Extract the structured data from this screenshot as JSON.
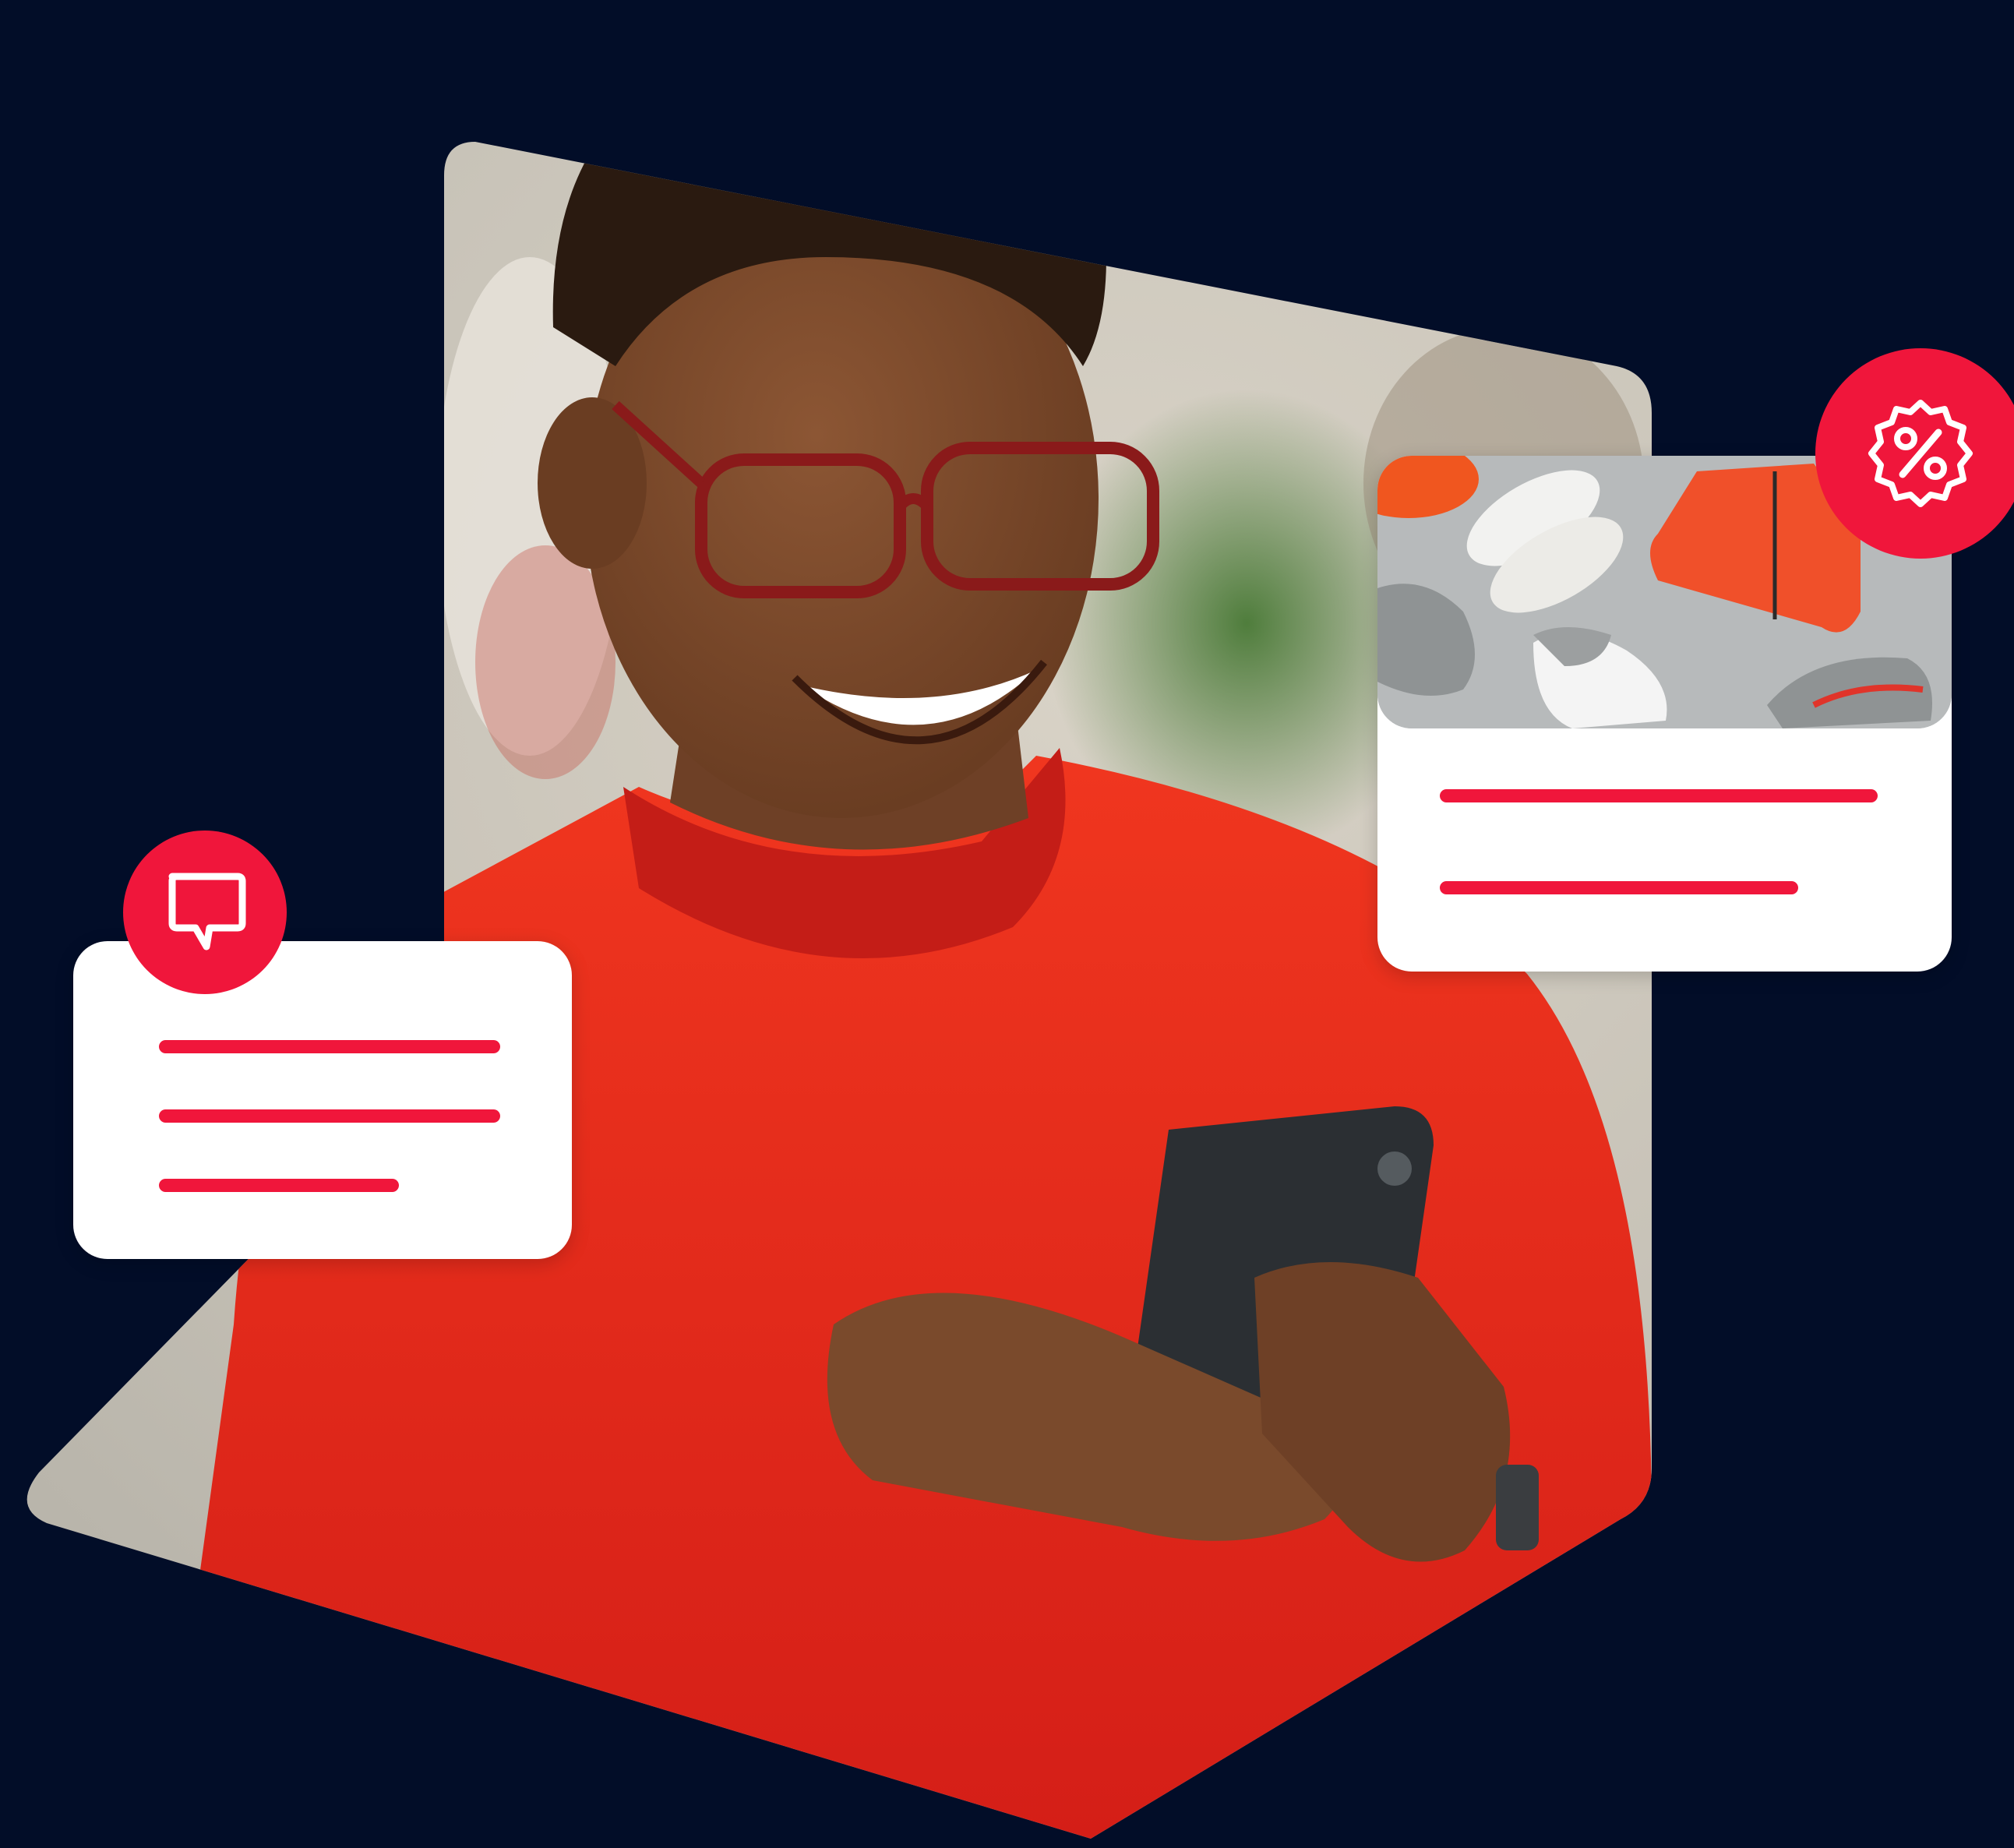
{
  "scene": {
    "description_icon_names": [
      "chat-bubble-icon",
      "discount-badge-icon"
    ]
  },
  "colors": {
    "background": "#020d28",
    "accent": "#f0163b",
    "card": "#ffffff",
    "sweater": "#e8291d",
    "skin": "#7a4a2c",
    "hair": "#2a1a10",
    "phone": "#2b2f33",
    "backdrop_light": "#e8e2d6",
    "backdrop_green": "#5f8a4a",
    "product_photo_bg": "#b9bcbd",
    "jacket": "#f0502a"
  },
  "icons": {
    "chat": "chat-bubble-icon",
    "discount": "discount-badge-icon"
  }
}
